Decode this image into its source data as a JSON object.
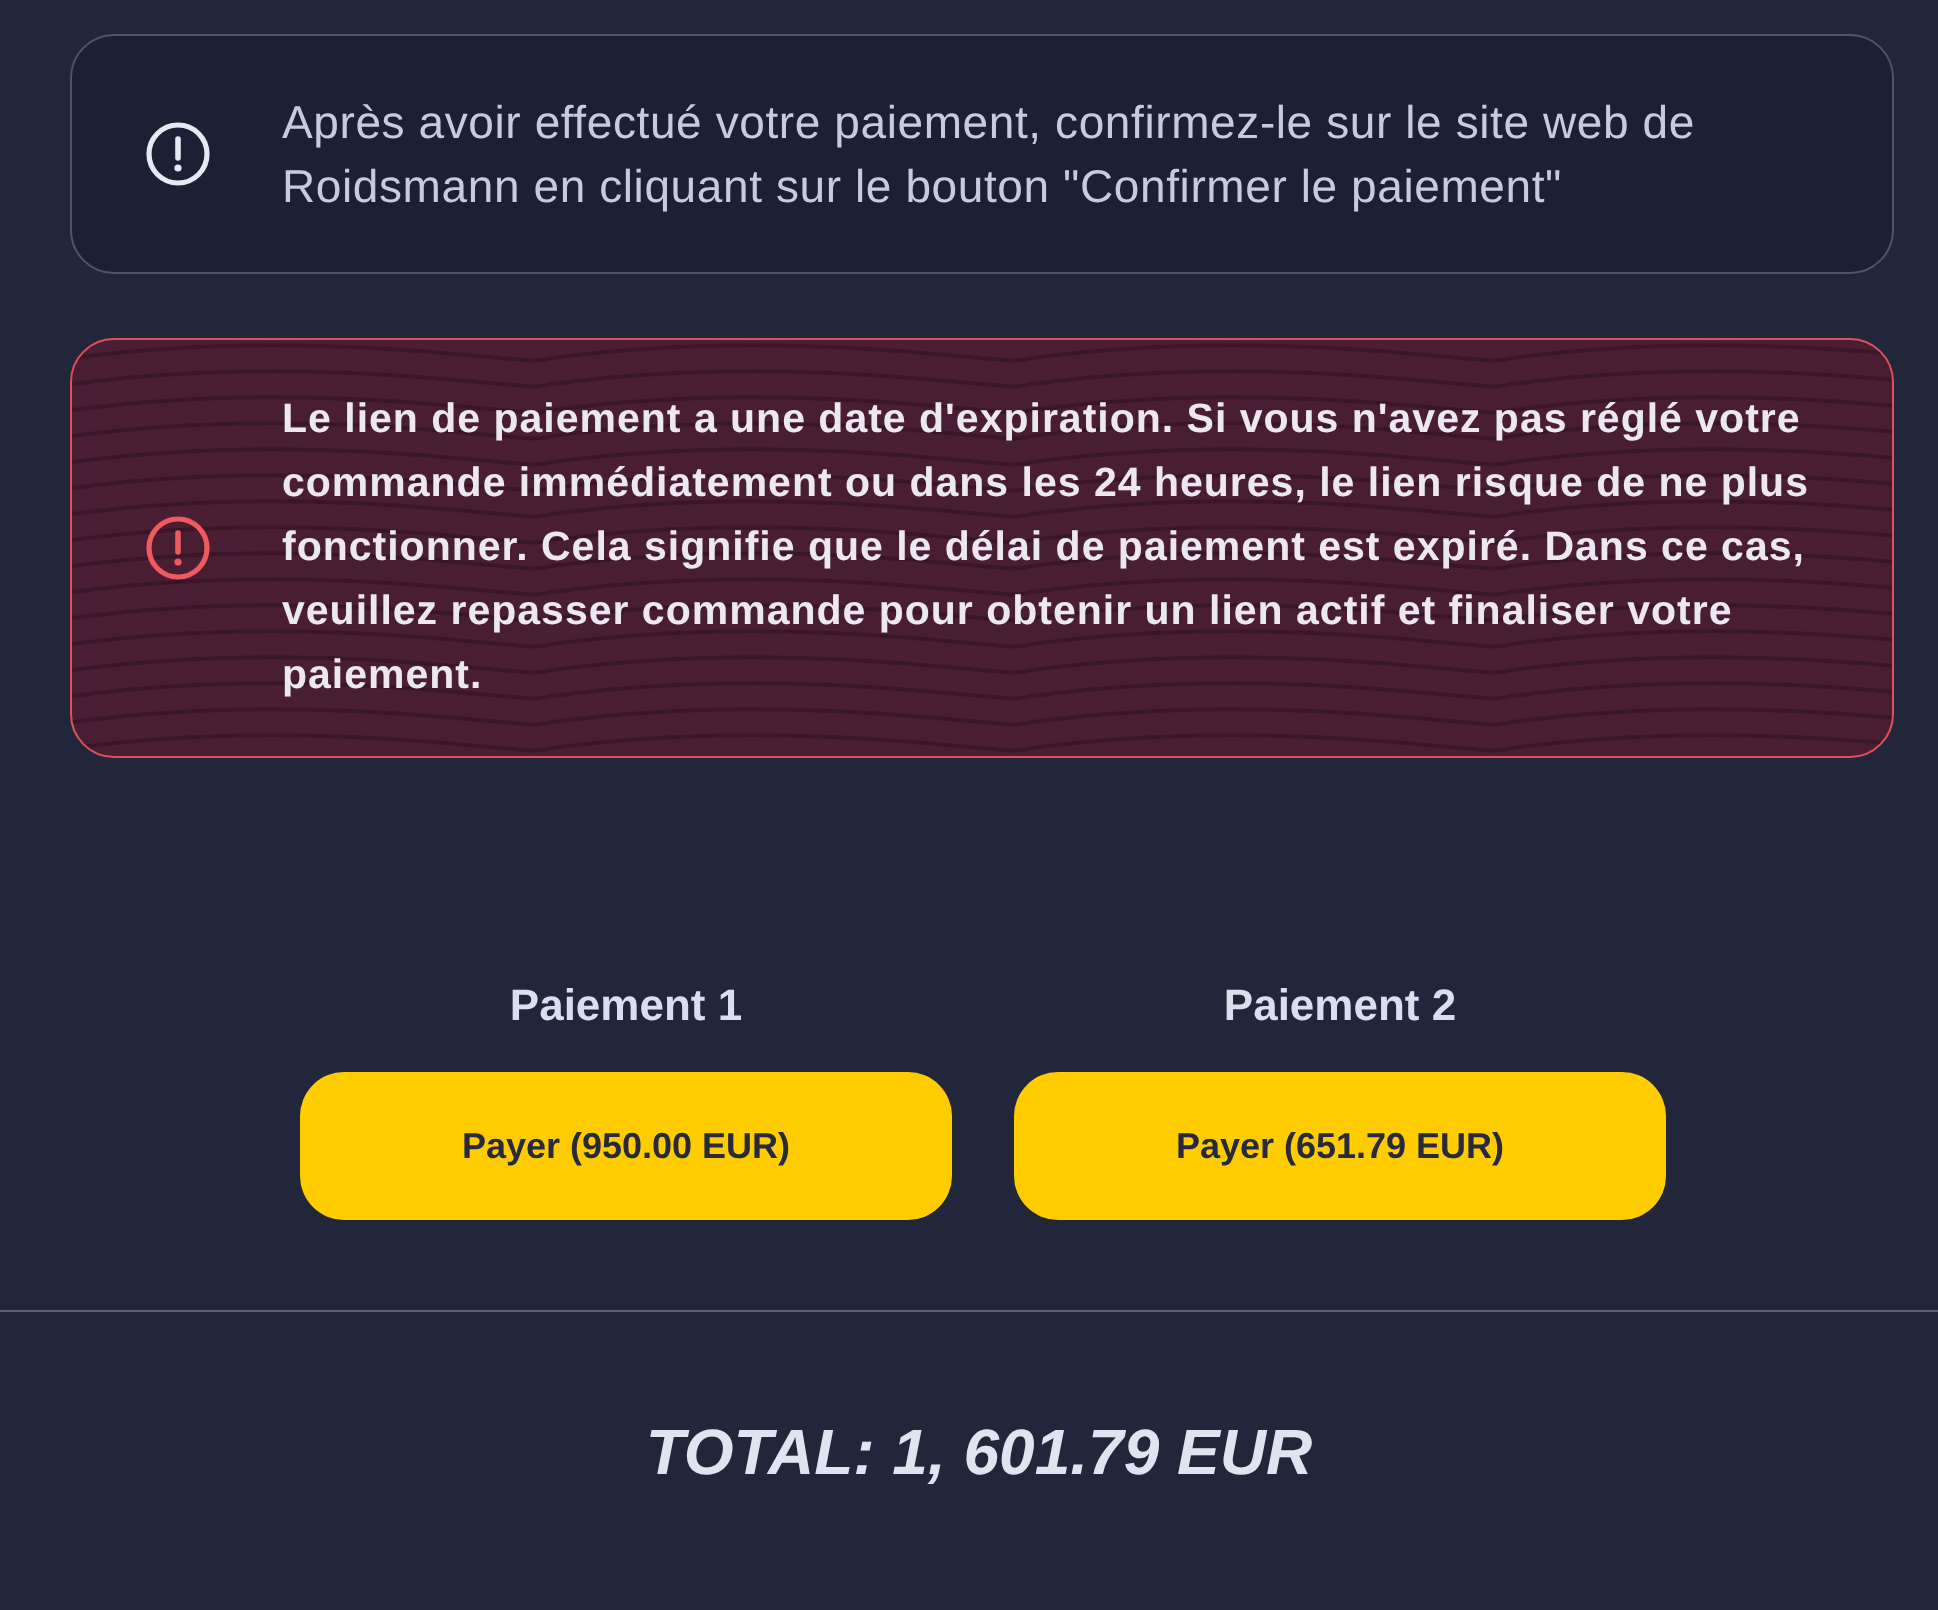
{
  "notices": [
    {
      "kind": "info",
      "text": "Après avoir effectué votre paiement, confirmez-le sur le site web de Roidsmann en cliquant sur le bouton \"Confirmer le paiement\""
    },
    {
      "kind": "warning",
      "text": "Le lien de paiement a une date d'expiration. Si vous n'avez pas réglé votre commande immédiatement ou dans les 24 heures, le lien risque de ne plus fonctionner. Cela signifie que le délai de paiement est expiré. Dans ce cas, veuillez repasser commande pour obtenir un lien actif et finaliser votre paiement."
    }
  ],
  "payments": [
    {
      "label": "Paiement 1",
      "button": "Payer (950.00 EUR)"
    },
    {
      "label": "Paiement 2",
      "button": "Payer (651.79 EUR)"
    }
  ],
  "total": "TOTAL: 1, 601.79 EUR"
}
